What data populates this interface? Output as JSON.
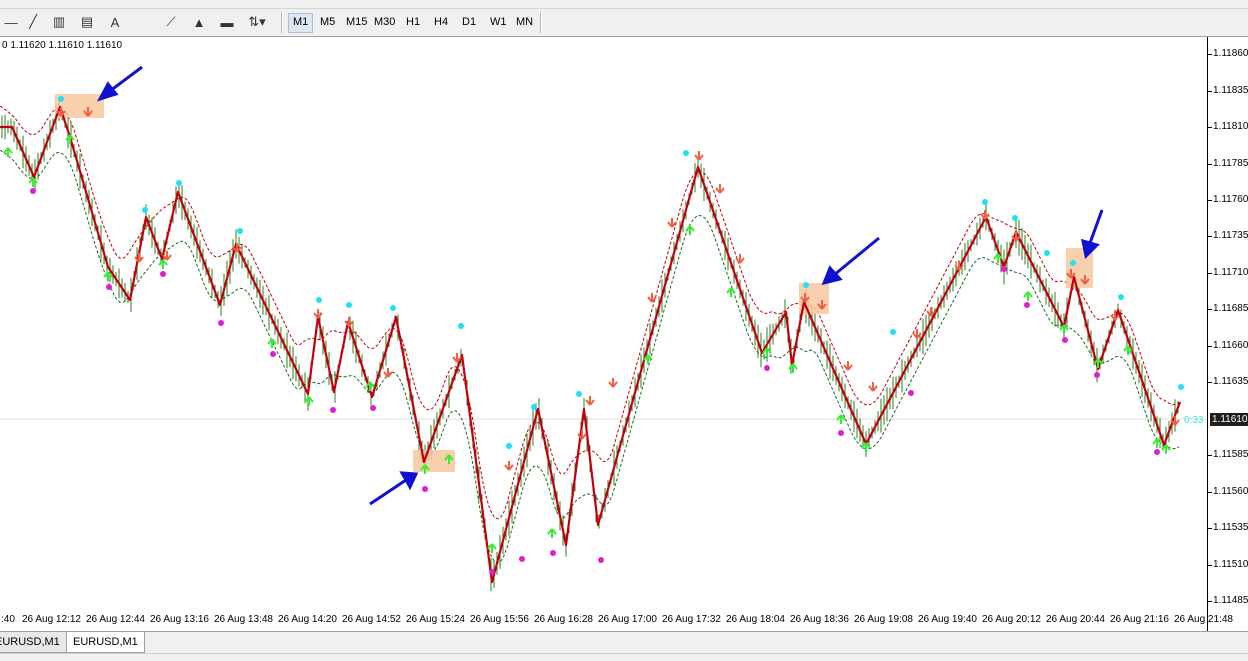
{
  "toolbar": {
    "tools": [
      {
        "icon": "line-tool-icon",
        "glyph": "╱"
      },
      {
        "icon": "channel-tool-icon",
        "glyph": "▥"
      },
      {
        "icon": "fibo-expansion-icon",
        "glyph": "▤"
      },
      {
        "icon": "text-tool-icon",
        "glyph": "A"
      },
      {
        "icon": "fibo-fan-icon",
        "glyph": "⟋"
      },
      {
        "icon": "triangle-tool-icon",
        "glyph": "▲"
      },
      {
        "icon": "rectangle-tool-icon",
        "glyph": "▬"
      },
      {
        "icon": "arrows-tool-icon",
        "glyph": "⇅"
      }
    ],
    "timeframes": [
      "M1",
      "M5",
      "M15",
      "M30",
      "H1",
      "H4",
      "D1",
      "W1",
      "MN"
    ],
    "active_timeframe": "M1"
  },
  "chart": {
    "info": "0 1.11620 1.11610 1.11610",
    "current_price": "1.11610",
    "timer": "0:33",
    "price_ticks": [
      "1.11860",
      "1.11835",
      "1.11810",
      "1.11785",
      "1.11760",
      "1.11735",
      "1.11710",
      "1.11685",
      "1.11660",
      "1.11635",
      "1.11610",
      "1.11585",
      "1.11560",
      "1.11535",
      "1.11510",
      "1.11485"
    ],
    "time_ticks": [
      ":40",
      "26 Aug 12:12",
      "26 Aug 12:44",
      "26 Aug 13:16",
      "26 Aug 13:48",
      "26 Aug 14:20",
      "26 Aug 14:52",
      "26 Aug 15:24",
      "26 Aug 15:56",
      "26 Aug 16:28",
      "26 Aug 17:00",
      "26 Aug 17:32",
      "26 Aug 18:04",
      "26 Aug 18:36",
      "26 Aug 19:08",
      "26 Aug 19:40",
      "26 Aug 20:12",
      "26 Aug 20:44",
      "26 Aug 21:16",
      "26 Aug 21:48"
    ],
    "colors": {
      "zigzag": "#c0000f",
      "bars": "#2e7d1e",
      "upper_band": "#c00000",
      "lower_band": "#1a6a1a",
      "buy_arrow": "#33ee33",
      "sell_arrow": "#f06040",
      "cyan_dot": "#22e0f0",
      "magenta_dot": "#e020d0",
      "highlight": "#f8c8a0",
      "annotation_arrow": "#1010d0"
    }
  },
  "tabs": [
    "EURUSD,M1",
    "EURUSD,M1"
  ],
  "active_tab": 1
}
